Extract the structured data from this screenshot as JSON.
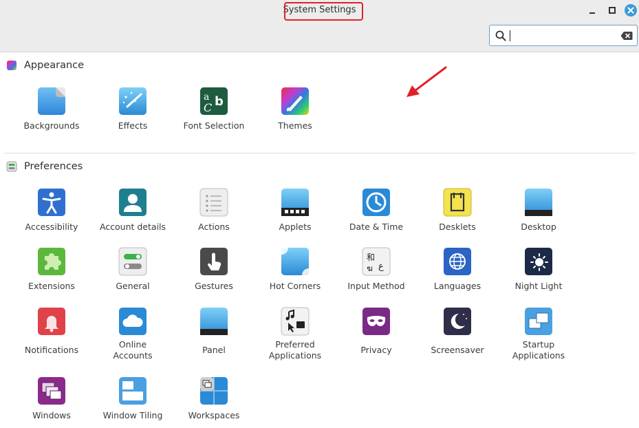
{
  "window": {
    "title": "System Settings"
  },
  "search": {
    "value": "",
    "placeholder": ""
  },
  "sections": [
    {
      "title": "Appearance",
      "items": [
        {
          "label": "Backgrounds"
        },
        {
          "label": "Effects"
        },
        {
          "label": "Font Selection"
        },
        {
          "label": "Themes"
        }
      ]
    },
    {
      "title": "Preferences",
      "items": [
        {
          "label": "Accessibility"
        },
        {
          "label": "Account details"
        },
        {
          "label": "Actions"
        },
        {
          "label": "Applets"
        },
        {
          "label": "Date & Time"
        },
        {
          "label": "Desklets"
        },
        {
          "label": "Desktop"
        },
        {
          "label": "Extensions"
        },
        {
          "label": "General"
        },
        {
          "label": "Gestures"
        },
        {
          "label": "Hot Corners"
        },
        {
          "label": "Input Method"
        },
        {
          "label": "Languages"
        },
        {
          "label": "Night Light"
        },
        {
          "label": "Notifications"
        },
        {
          "label": "Online\nAccounts"
        },
        {
          "label": "Panel"
        },
        {
          "label": "Preferred\nApplications"
        },
        {
          "label": "Privacy"
        },
        {
          "label": "Screensaver"
        },
        {
          "label": "Startup\nApplications"
        },
        {
          "label": "Windows"
        },
        {
          "label": "Window Tiling"
        },
        {
          "label": "Workspaces"
        }
      ]
    }
  ],
  "colors": {
    "accent": "#3c9bd6",
    "annotation": "#e0202a"
  }
}
